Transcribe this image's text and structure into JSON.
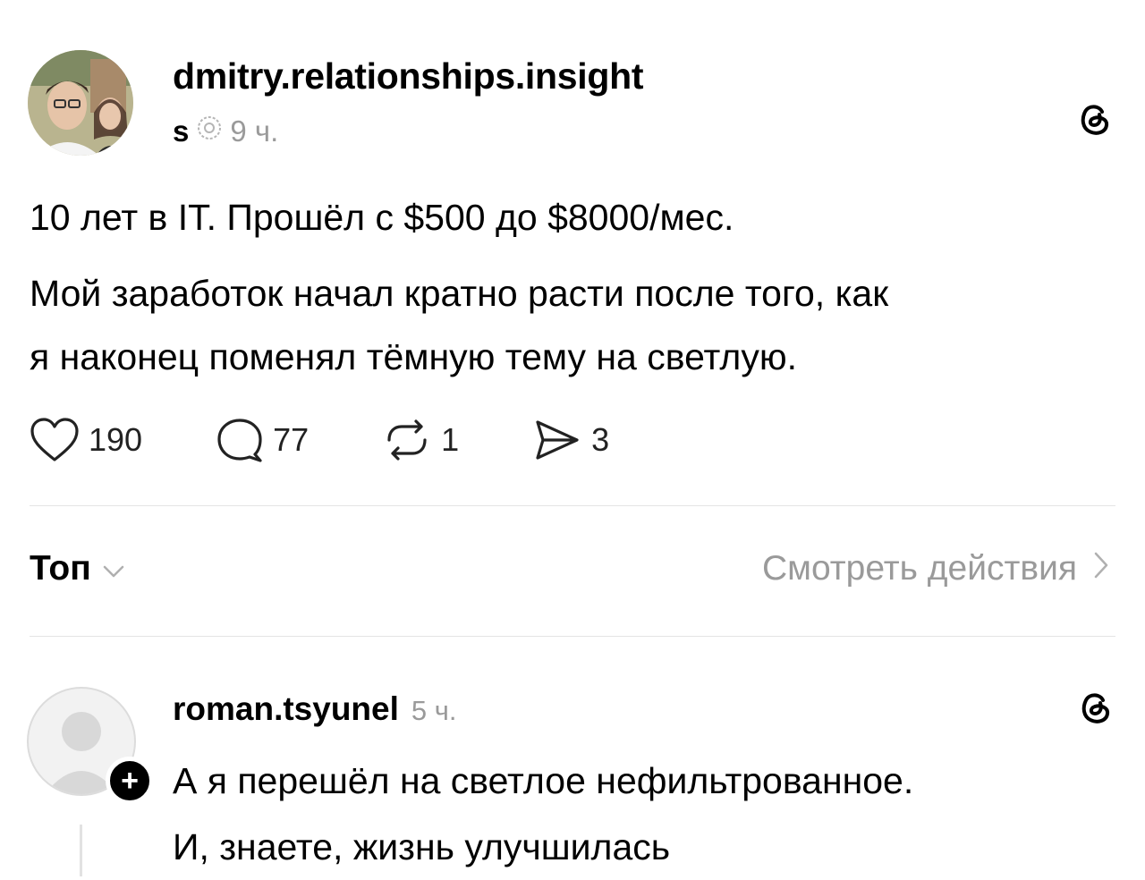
{
  "post": {
    "username": "dmitry.relationships.insight",
    "badge_letter": "s",
    "time": "9 ч.",
    "line1": "10 лет в IT. Прошёл с $500 до $8000/мес.",
    "line2": "Мой заработок начал кратно расти после того, как",
    "line3": "я наконец поменял тёмную тему на светлую.",
    "likes": "190",
    "comments": "77",
    "reposts": "1",
    "shares": "3"
  },
  "sort": {
    "label": "Топ",
    "activity_label": "Смотреть действия"
  },
  "comment": {
    "username": "roman.tsyunel",
    "time": "5 ч.",
    "line1": "А я перешёл на светлое нефильтрованное.",
    "line2": "И, знаете, жизнь улучшилась"
  },
  "icons": {
    "threads": "threads-logo-icon",
    "like": "heart-icon",
    "comment": "comment-bubble-icon",
    "repost": "repost-icon",
    "share": "send-icon"
  }
}
